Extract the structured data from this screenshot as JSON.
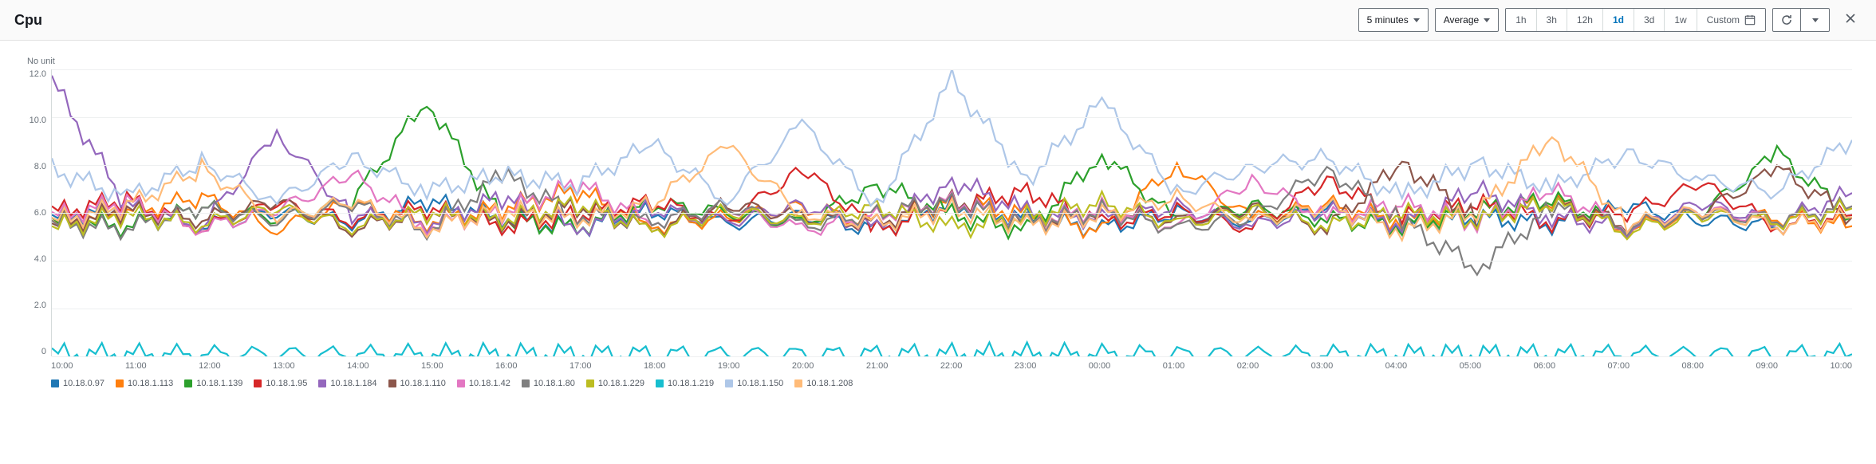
{
  "header": {
    "title": "Cpu",
    "period_dropdown": "5 minutes",
    "stat_dropdown": "Average",
    "ranges": [
      "1h",
      "3h",
      "12h",
      "1d",
      "3d",
      "1w"
    ],
    "range_active_index": 3,
    "custom_label": "Custom"
  },
  "chart_data": {
    "type": "line",
    "title": "Cpu",
    "ylabel": "No unit",
    "xlabel": "",
    "ylim": [
      0,
      13
    ],
    "y_ticks": [
      "12.0",
      "10.0",
      "8.0",
      "6.0",
      "4.0",
      "2.0",
      "0"
    ],
    "x_ticks": [
      "10:00",
      "11:00",
      "12:00",
      "13:00",
      "14:00",
      "15:00",
      "16:00",
      "17:00",
      "18:00",
      "19:00",
      "20:00",
      "21:00",
      "22:00",
      "23:00",
      "00:00",
      "01:00",
      "02:00",
      "03:00",
      "04:00",
      "05:00",
      "06:00",
      "07:00",
      "08:00",
      "09:00",
      "10:00"
    ],
    "series": [
      {
        "name": "10.18.0.97",
        "color": "#1f77b4",
        "values": [
          6.2,
          6.8,
          5.9,
          6.5,
          6.1,
          7.0,
          6.3,
          5.8,
          6.6,
          6.0,
          6.4,
          5.7,
          6.9,
          6.2,
          5.8,
          6.5,
          6.1,
          6.7,
          5.9,
          6.3,
          6.0,
          6.8,
          6.2,
          5.9,
          6.4
        ]
      },
      {
        "name": "10.18.1.113",
        "color": "#ff7f0e",
        "values": [
          6.0,
          6.5,
          7.2,
          5.8,
          6.9,
          6.1,
          6.7,
          7.5,
          5.9,
          6.3,
          6.8,
          6.0,
          7.1,
          6.4,
          5.7,
          8.7,
          6.2,
          6.9,
          6.1,
          6.6,
          7.0,
          5.8,
          6.5,
          6.3,
          5.9
        ]
      },
      {
        "name": "10.18.1.139",
        "color": "#2ca02c",
        "values": [
          6.1,
          5.9,
          6.7,
          6.3,
          7.0,
          11.6,
          6.2,
          5.8,
          6.9,
          6.5,
          6.0,
          7.8,
          6.4,
          5.7,
          9.2,
          6.1,
          6.8,
          6.2,
          5.9,
          6.6,
          7.1,
          6.0,
          6.5,
          9.2,
          6.3
        ]
      },
      {
        "name": "10.18.1.95",
        "color": "#d62728",
        "values": [
          6.5,
          7.1,
          5.8,
          6.9,
          6.2,
          6.7,
          5.9,
          6.4,
          7.0,
          6.1,
          8.5,
          5.7,
          6.8,
          7.5,
          6.0,
          6.6,
          5.8,
          8.0,
          6.3,
          6.9,
          6.1,
          6.5,
          7.8,
          5.9,
          6.4
        ]
      },
      {
        "name": "10.18.1.184",
        "color": "#9467bd",
        "values": [
          12.5,
          6.8,
          5.9,
          10.1,
          6.4,
          6.0,
          7.2,
          5.8,
          6.7,
          6.1,
          6.9,
          5.7,
          8.0,
          6.5,
          6.2,
          6.8,
          5.9,
          6.6,
          6.0,
          7.5,
          6.3,
          5.8,
          6.9,
          6.1,
          7.4
        ]
      },
      {
        "name": "10.18.1.110",
        "color": "#8c564b",
        "values": [
          5.9,
          6.6,
          6.2,
          7.0,
          5.8,
          6.5,
          6.1,
          6.8,
          5.7,
          6.9,
          6.3,
          6.0,
          7.2,
          5.9,
          6.6,
          6.1,
          6.7,
          5.8,
          8.8,
          6.2,
          6.9,
          6.0,
          6.5,
          8.5,
          6.3
        ]
      },
      {
        "name": "10.18.1.42",
        "color": "#e377c2",
        "values": [
          6.3,
          7.0,
          5.8,
          6.6,
          8.2,
          5.9,
          6.5,
          7.8,
          6.1,
          6.8,
          5.7,
          6.4,
          7.1,
          6.0,
          6.7,
          5.8,
          8.0,
          6.3,
          6.9,
          6.1,
          7.5,
          5.9,
          6.6,
          6.2,
          6.8
        ]
      },
      {
        "name": "10.18.1.80",
        "color": "#7f7f7f",
        "values": [
          6.0,
          5.8,
          6.7,
          6.2,
          6.9,
          5.7,
          8.2,
          6.4,
          6.1,
          6.8,
          5.9,
          6.5,
          7.0,
          6.0,
          6.6,
          5.8,
          6.3,
          8.5,
          6.1,
          4.0,
          6.7,
          5.9,
          6.5,
          6.2,
          6.8
        ]
      },
      {
        "name": "10.18.1.229",
        "color": "#bcbd22",
        "values": [
          5.8,
          6.4,
          6.0,
          6.7,
          5.9,
          6.5,
          6.2,
          6.9,
          5.7,
          6.6,
          6.1,
          6.8,
          5.8,
          6.3,
          7.0,
          6.0,
          6.6,
          5.9,
          6.5,
          6.2,
          6.9,
          5.7,
          6.4,
          6.1,
          6.7
        ]
      },
      {
        "name": "10.18.1.219",
        "color": "#17becf",
        "values": [
          0.1,
          0.1,
          0.1,
          0.1,
          0.1,
          0.1,
          0.1,
          0.1,
          0.1,
          0.1,
          0.1,
          0.1,
          0.1,
          0.1,
          0.1,
          0.1,
          0.1,
          0.1,
          0.1,
          0.1,
          0.1,
          0.1,
          0.1,
          0.1,
          0.1
        ]
      },
      {
        "name": "10.18.1.150",
        "color": "#aec7e8",
        "values": [
          8.5,
          7.2,
          8.8,
          7.0,
          9.0,
          7.5,
          8.2,
          7.8,
          9.6,
          7.1,
          10.5,
          6.9,
          12.5,
          8.0,
          11.5,
          7.4,
          8.6,
          9.0,
          7.2,
          8.8,
          7.6,
          9.2,
          8.0,
          7.5,
          9.8
        ]
      },
      {
        "name": "10.18.1.208",
        "color": "#ffbb78",
        "values": [
          6.1,
          6.8,
          8.5,
          6.3,
          7.0,
          5.8,
          6.6,
          6.2,
          6.9,
          9.5,
          6.5,
          6.0,
          6.7,
          5.9,
          6.4,
          7.2,
          6.1,
          6.8,
          5.7,
          6.5,
          10.0,
          6.0,
          6.6,
          5.9,
          6.3
        ]
      }
    ]
  }
}
